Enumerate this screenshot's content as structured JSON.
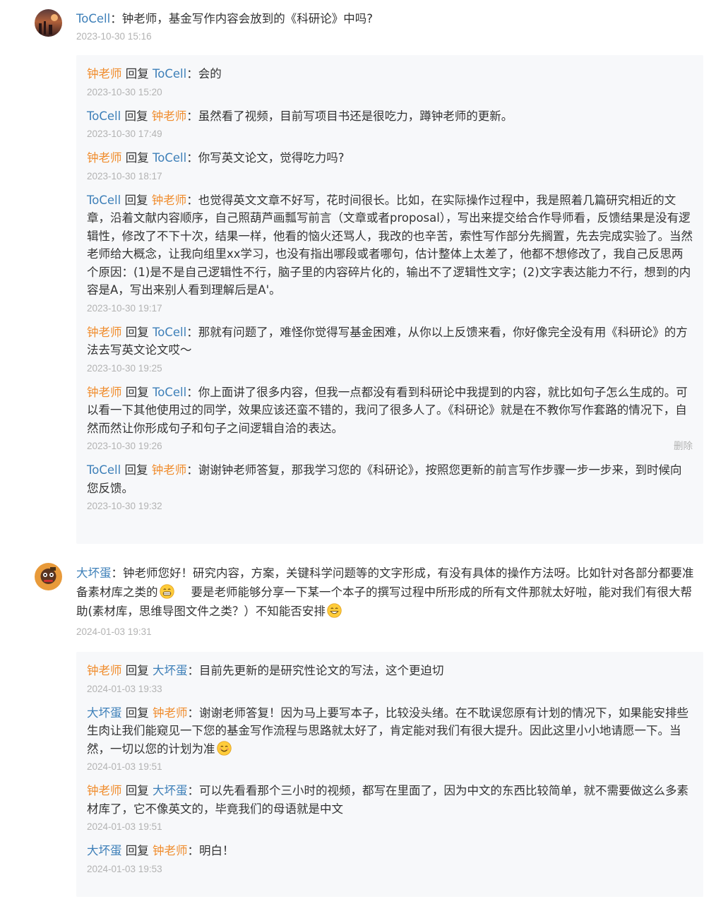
{
  "threads": [
    {
      "author": "ToCell",
      "sep": "：",
      "text": "钟老师，基金写作内容会放到的《科研论》中吗?",
      "time": "2023-10-30 15:16",
      "replies": [
        {
          "from": "钟老师",
          "mid": " 回复 ",
          "to": "ToCell",
          "sep": "：",
          "text": "会的",
          "time": "2023-10-30 15:20"
        },
        {
          "from": "ToCell",
          "mid": " 回复 ",
          "to": "钟老师",
          "sep": "：",
          "text": "虽然看了视频，目前写项目书还是很吃力，蹲钟老师的更新。",
          "time": "2023-10-30 17:49"
        },
        {
          "from": "钟老师",
          "mid": " 回复 ",
          "to": "ToCell",
          "sep": "：",
          "text": "你写英文论文，觉得吃力吗?",
          "time": "2023-10-30 18:17"
        },
        {
          "from": "ToCell",
          "mid": " 回复 ",
          "to": "钟老师",
          "sep": "：",
          "text": "也觉得英文文章不好写，花时间很长。比如，在实际操作过程中，我是照着几篇研究相近的文章，沿着文献内容顺序，自己照葫芦画瓢写前言（文章或者proposal），写出来提交给合作导师看，反馈结果是没有逻辑性，修改了不下十次，结果一样，他看的恼火还骂人，我改的也辛苦，索性写作部分先搁置，先去完成实验了。当然老师给大概念，让我向组里xx学习，也没有指出哪段或者哪句，估计整体上太差了，他都不想修改了，我自己反思两个原因：(1)是不是自己逻辑性不行，脑子里的内容碎片化的，输出不了逻辑性文字；(2)文字表达能力不行，想到的内容是A，写出来别人看到理解后是A'。",
          "time": "2023-10-30 19:17"
        },
        {
          "from": "钟老师",
          "mid": " 回复 ",
          "to": "ToCell",
          "sep": "：",
          "text": "那就有问题了，难怪你觉得写基金困难，从你以上反馈来看，你好像完全没有用《科研论》的方法去写英文论文哎～",
          "time": "2023-10-30 19:25"
        },
        {
          "from": "钟老师",
          "mid": " 回复 ",
          "to": "ToCell",
          "sep": "：",
          "text": "你上面讲了很多内容，但我一点都没有看到科研论中我提到的内容，就比如句子怎么生成的。可以看一下其他使用过的同学，效果应该还蛮不错的，我问了很多人了。《科研论》就是在不教你写作套路的情况下，自然而然让你形成句子和句子之间逻辑自洽的表达。",
          "time": "2023-10-30 19:26",
          "action": "删除"
        },
        {
          "from": "ToCell",
          "mid": " 回复 ",
          "to": "钟老师",
          "sep": "：",
          "text": "谢谢钟老师答复，那我学习您的《科研论》，按照您更新的前言写作步骤一步一步来，到时候向您反馈。",
          "time": "2023-10-30 19:32"
        }
      ]
    },
    {
      "author": "大坏蛋",
      "sep": "：",
      "text_a": "钟老师您好！研究内容，方案，关键科学问题等的文字形成，有没有具体的操作方法呀。比如针对各部分都要准备素材库之类的",
      "emoji_a": "grinning-emoji",
      "text_b": "要是老师能够分享一下某一个本子的撰写过程中所形成的所有文件那就太好啦，能对我们有很大帮助(素材库，思维导图文件之类？）不知能否安排",
      "emoji_b": "smile-emoji",
      "time": "2024-01-03 19:31",
      "replies": [
        {
          "from": "钟老师",
          "mid": " 回复 ",
          "to": "大坏蛋",
          "sep": "：",
          "text": "目前先更新的是研究性论文的写法，这个更迫切",
          "time": "2024-01-03 19:33"
        },
        {
          "from": "大坏蛋",
          "mid": " 回复 ",
          "to": "钟老师",
          "sep": "：",
          "text": "谢谢老师答复！因为马上要写本子，比较没头绪。在不耽误您原有计划的情况下，如果能安排些生肉让我们能窥见一下您的基金写作流程与思路就太好了，肯定能对我们有很大提升。因此这里小小地请愿一下。当然，一切以您的计划为准",
          "emoji": "blush-emoji",
          "time": "2024-01-03 19:51"
        },
        {
          "from": "钟老师",
          "mid": " 回复 ",
          "to": "大坏蛋",
          "sep": "：",
          "text": "可以先看看那个三小时的视频，都写在里面了，因为中文的东西比较简单，就不需要做这么多素材库了，它不像英文的，毕竟我们的母语就是中文",
          "time": "2024-01-03 19:51"
        },
        {
          "from": "大坏蛋",
          "mid": " 回复 ",
          "to": "钟老师",
          "sep": "：",
          "text": "明白！",
          "time": "2024-01-03 19:53"
        }
      ]
    }
  ],
  "colors": {
    "author_blue": "#3d7fb8",
    "author_orange": "#f08d2e",
    "time_gray": "#b3b3b3",
    "reply_bg": "#f7f8fa"
  }
}
